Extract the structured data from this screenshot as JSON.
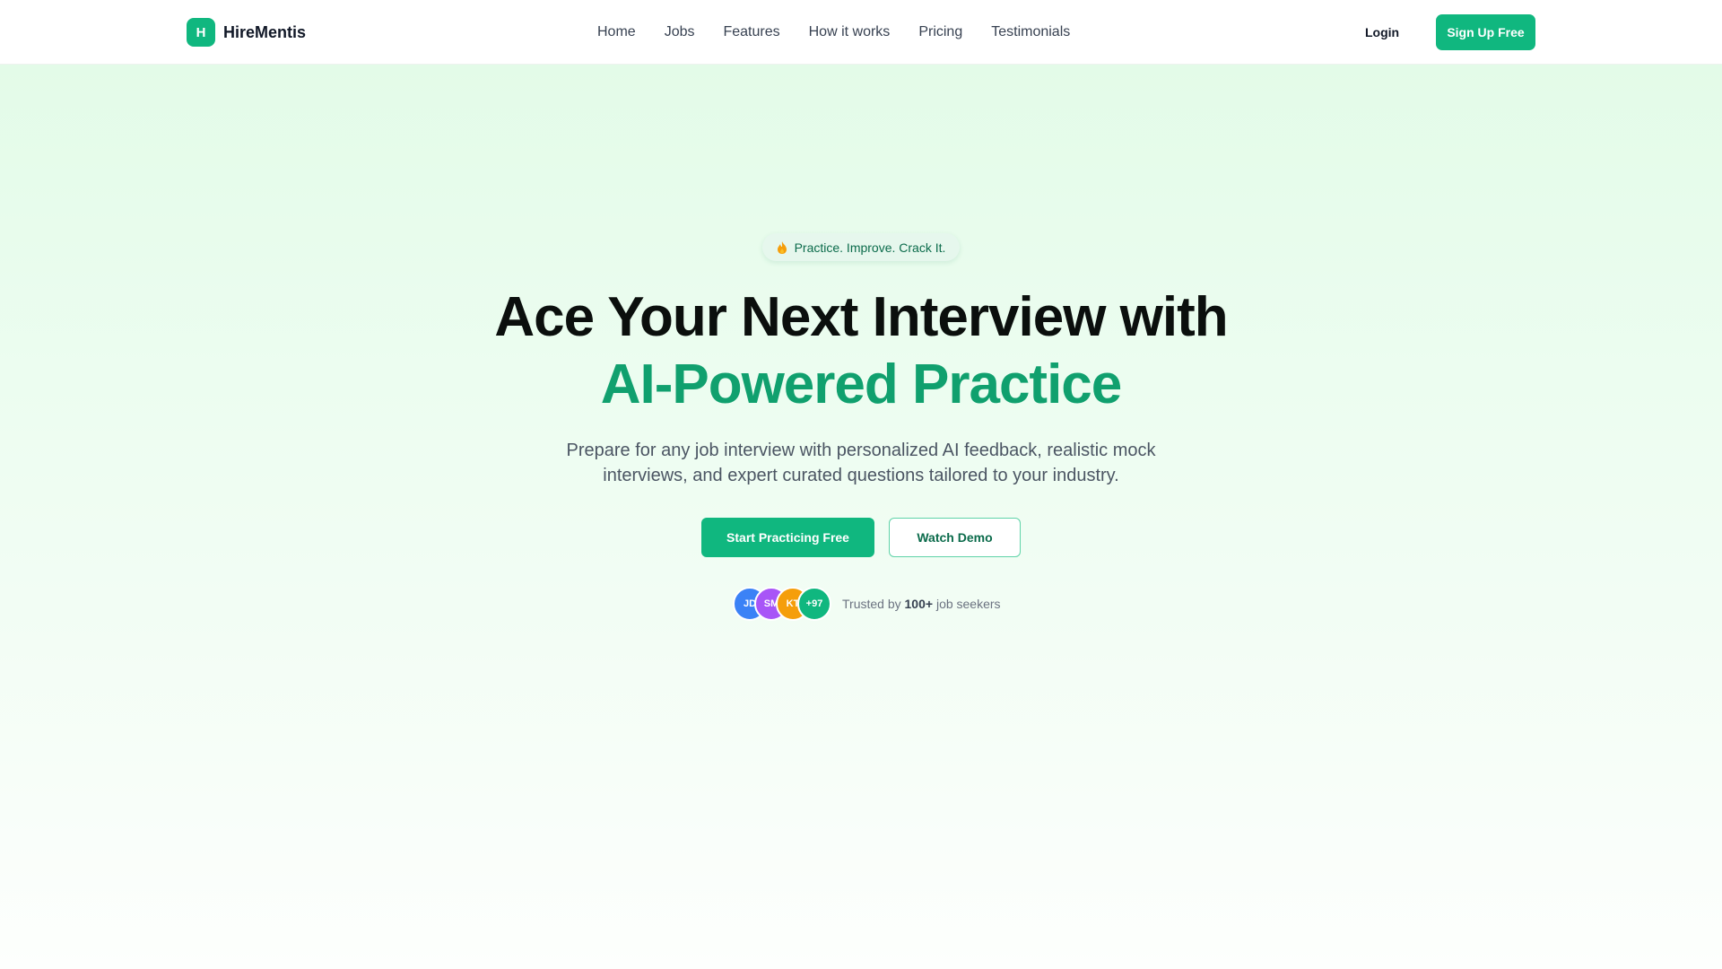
{
  "brand": {
    "logo_letter": "H",
    "name": "HireMentis",
    "accent_color": "#10b77f"
  },
  "nav": {
    "items": [
      "Home",
      "Jobs",
      "Features",
      "How it works",
      "Pricing",
      "Testimonials"
    ]
  },
  "header": {
    "login_label": "Login",
    "signup_label": "Sign Up Free"
  },
  "hero": {
    "badge_icon": "flame-icon",
    "badge_text": "Practice. Improve. Crack It.",
    "headline_line1": "Ace Your Next Interview with",
    "headline_line2": "AI-Powered Practice",
    "subtitle": "Prepare for any job interview with personalized AI feedback, realistic mock interviews, and expert curated questions tailored to your industry.",
    "primary_cta": "Start Practicing Free",
    "secondary_cta": "Watch Demo"
  },
  "social_proof": {
    "avatars": [
      {
        "initials": "JD",
        "color": "#3b82f6"
      },
      {
        "initials": "SM",
        "color": "#a855f7"
      },
      {
        "initials": "KT",
        "color": "#f59e0b"
      },
      {
        "initials": "+97",
        "color": "#10b77f"
      }
    ],
    "text_prefix": "Trusted by ",
    "count": "100+",
    "text_suffix": " job seekers"
  }
}
